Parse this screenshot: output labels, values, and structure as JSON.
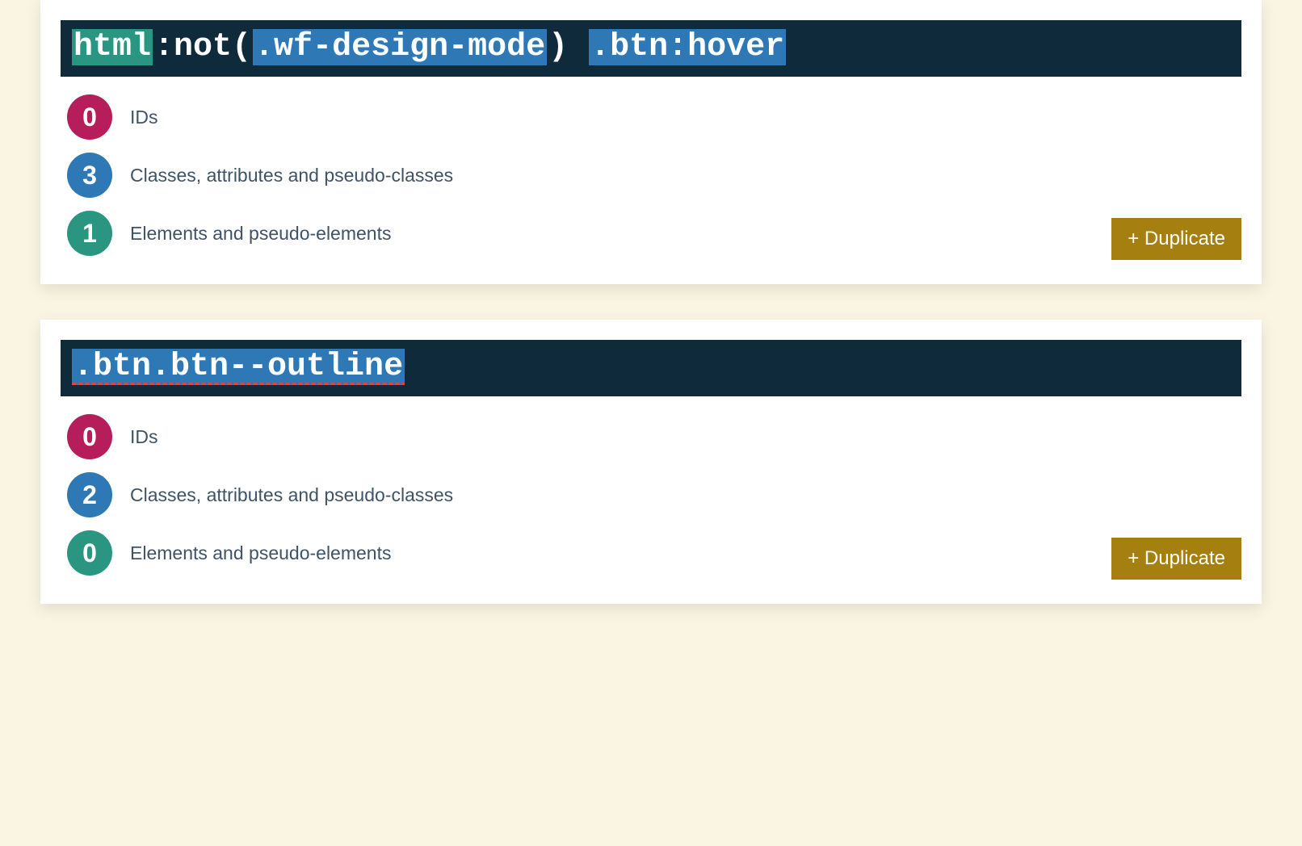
{
  "labels": {
    "ids": "IDs",
    "classes": "Classes, attributes and pseudo-classes",
    "elements": "Elements and pseudo-elements",
    "duplicate": "+ Duplicate"
  },
  "cards": [
    {
      "selector_tokens": [
        {
          "type": "elem",
          "text": "html"
        },
        {
          "type": "plain",
          "text": ":not("
        },
        {
          "type": "class",
          "text": ".wf-design-mode"
        },
        {
          "type": "plain",
          "text": ") "
        },
        {
          "type": "class",
          "text": ".btn:hover",
          "redline": false
        }
      ],
      "counts": {
        "ids": 0,
        "classes": 3,
        "elements": 1
      }
    },
    {
      "selector_tokens": [
        {
          "type": "class",
          "text": ".btn.btn--outline",
          "redline": true
        }
      ],
      "counts": {
        "ids": 0,
        "classes": 2,
        "elements": 0
      }
    }
  ]
}
